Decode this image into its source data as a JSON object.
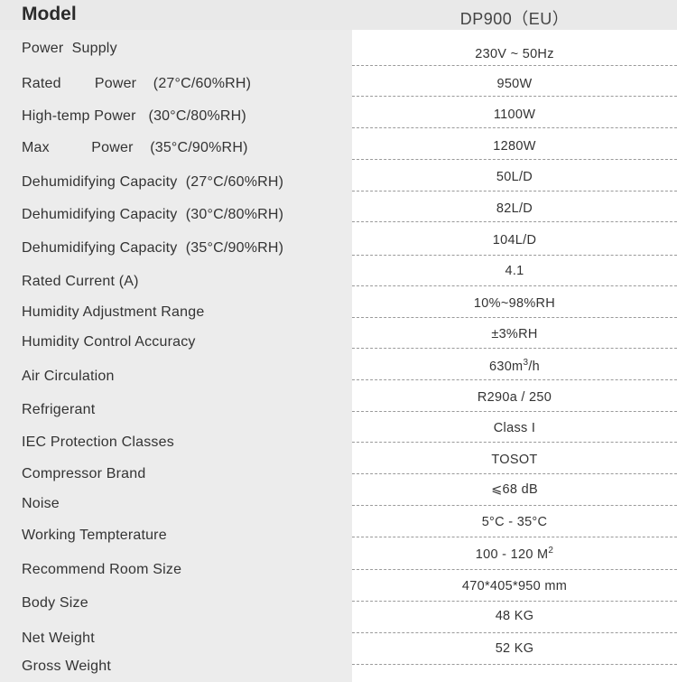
{
  "header": {
    "label": "Model",
    "value": "DP900（EU）"
  },
  "rows": [
    {
      "label": "Power  Supply",
      "value": "230V ~ 50Hz"
    },
    {
      "label": "Rated        Power    (27°C/60%RH)",
      "value": "950W"
    },
    {
      "label": "High-temp Power   (30°C/80%RH)",
      "value": "1100W"
    },
    {
      "label": "Max          Power    (35°C/90%RH)",
      "value": "1280W"
    },
    {
      "label": "Dehumidifying Capacity  (27°C/60%RH)",
      "value": "50L/D"
    },
    {
      "label": "Dehumidifying Capacity  (30°C/80%RH)",
      "value": "82L/D"
    },
    {
      "label": "Dehumidifying Capacity  (35°C/90%RH)",
      "value": "104L/D"
    },
    {
      "label": "Rated Current (A)",
      "value": "4.1"
    },
    {
      "label": "Humidity Adjustment Range",
      "value": "10%~98%RH"
    },
    {
      "label": "Humidity Control Accuracy",
      "value": "±3%RH"
    },
    {
      "label": "Air Circulation",
      "value": "630m",
      "value_sup": "3",
      "value_tail": "/h"
    },
    {
      "label": "Refrigerant",
      "value": "R290a / 250"
    },
    {
      "label": "IEC Protection Classes",
      "value": "Class I"
    },
    {
      "label": "Compressor Brand",
      "value": "TOSOT"
    },
    {
      "label": "Noise",
      "value": "⩽68 dB"
    },
    {
      "label": "Working Tempterature",
      "value": "5°C - 35°C"
    },
    {
      "label": "Recommend Room Size",
      "value": "100 - 120 M",
      "value_sup": "2",
      "value_tail": ""
    },
    {
      "label": "Body Size",
      "value": "470*405*950 mm"
    },
    {
      "label": "Net Weight",
      "value": "48 KG"
    },
    {
      "label": "Gross Weight",
      "value": "52 KG"
    }
  ]
}
